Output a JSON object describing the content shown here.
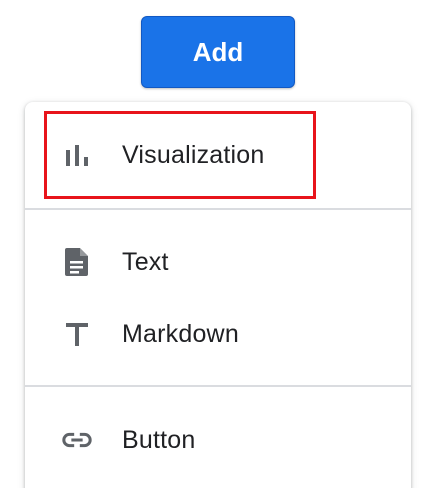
{
  "add_button": {
    "label": "Add"
  },
  "menu": {
    "items": [
      {
        "label": "Visualization",
        "icon": "bar-chart-icon"
      },
      {
        "label": "Text",
        "icon": "document-icon"
      },
      {
        "label": "Markdown",
        "icon": "text-t-icon"
      },
      {
        "label": "Button",
        "icon": "link-icon"
      }
    ]
  },
  "colors": {
    "accent": "#1a73e8",
    "highlight": "#e8141b",
    "icon": "#5f6368",
    "text": "#202124",
    "divider": "#dadce0"
  }
}
